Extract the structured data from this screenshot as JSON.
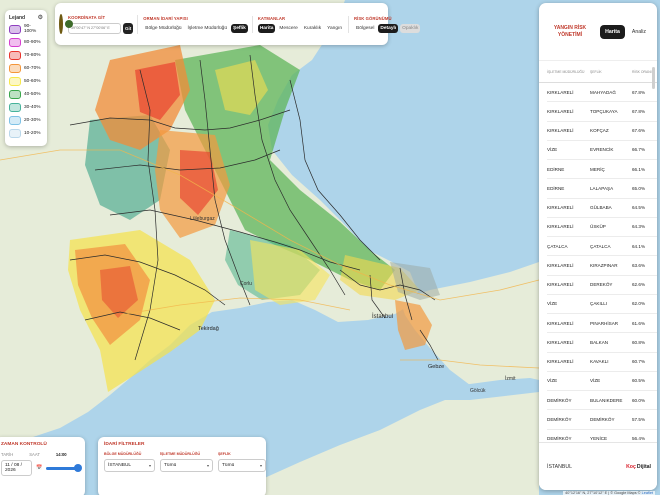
{
  "legend": {
    "title": "Lejand",
    "items": [
      {
        "label": "90-100%",
        "color": "#8e3fbf"
      },
      {
        "label": "80-90%",
        "color": "#d63fd0"
      },
      {
        "label": "70-80%",
        "color": "#e8342d"
      },
      {
        "label": "60-70%",
        "color": "#f4963a"
      },
      {
        "label": "50-60%",
        "color": "#f6e84b"
      },
      {
        "label": "40-50%",
        "color": "#3aa64b"
      },
      {
        "label": "30-40%",
        "color": "#46b39b"
      },
      {
        "label": "20-30%",
        "color": "#7ec2e6"
      },
      {
        "label": "10-20%",
        "color": "#b9d7ea"
      }
    ]
  },
  "toolbar": {
    "coord": {
      "title": "KOORDİNATA GİT",
      "placeholder": "39°00'47\" N 27°00'06\" E",
      "go_label": "Git"
    },
    "admin": {
      "title": "ORMAN İDARİ YAPISI",
      "options": [
        "Bölge Müdürlüğü",
        "İşletme Müdürlüğü",
        "Şeflik"
      ],
      "active_index": 2
    },
    "layers": {
      "title": "KATMANLAR",
      "options": [
        "Harita",
        "Mescere",
        "Kuraklık",
        "Yangın"
      ],
      "active_index": 0
    },
    "risk": {
      "title": "RİSK GÖRÜNÜMÜ",
      "options": [
        "Bölgesel",
        "Detaylı",
        "Opaklık"
      ],
      "active_index": 1,
      "dim_index": 2
    }
  },
  "panel": {
    "title": "YANGIN RİSK YÖNETİMİ",
    "toggle": [
      "Harita",
      "Analiz"
    ],
    "toggle_active": 0,
    "columns": [
      "İŞLETME MÜDÜRLÜĞÜ",
      "ŞEFLİK",
      "RİSK ORANI"
    ],
    "rows": [
      [
        "KIRKLARELİ",
        "MAHYADAĞ",
        "67.8%"
      ],
      [
        "KIRKLARELİ",
        "TOPÇUKAYA",
        "67.8%"
      ],
      [
        "KIRKLARELİ",
        "KOFÇAZ",
        "67.6%"
      ],
      [
        "VİZE",
        "EVRENCİK",
        "66.7%"
      ],
      [
        "EDİRNE",
        "MERİÇ",
        "66.1%"
      ],
      [
        "EDİRNE",
        "LALAPAŞA",
        "65.0%"
      ],
      [
        "KIRKLARELİ",
        "GÜLBABA",
        "64.5%"
      ],
      [
        "KIRKLARELİ",
        "ÜSKÜP",
        "64.3%"
      ],
      [
        "ÇATALCA",
        "ÇATALCA",
        "64.1%"
      ],
      [
        "KIRKLARELİ",
        "KIRAZPINAR",
        "63.6%"
      ],
      [
        "KIRKLARELİ",
        "DEREKÖY",
        "62.6%"
      ],
      [
        "VİZE",
        "ÇAKILLI",
        "62.0%"
      ],
      [
        "KIRKLARELİ",
        "PINARHİSAR",
        "61.6%"
      ],
      [
        "KIRKLARELİ",
        "BALKAN",
        "60.8%"
      ],
      [
        "KIRKLARELİ",
        "KAVAKLI",
        "60.7%"
      ],
      [
        "VİZE",
        "VİZE",
        "60.5%"
      ],
      [
        "DEMİRKÖY",
        "BULANIKDERE",
        "60.0%"
      ],
      [
        "DEMİRKÖY",
        "DEMİRKÖY",
        "57.5%"
      ],
      [
        "DEMİRKÖY",
        "YENİCE",
        "56.4%"
      ]
    ],
    "footer_region": "İSTANBUL",
    "footer_logo_red": "Koç",
    "footer_logo": "Dijital"
  },
  "time_control": {
    "title": "ZAMAN KONTROLÜ",
    "date_label": "TARİH",
    "time_label": "SAAT",
    "time_value": "14:00",
    "date_value": "11 / 08 / 2026"
  },
  "filters": {
    "title": "İDARİ FİLTRELER",
    "fields": [
      {
        "label": "BÖLGE MÜDÜRLÜĞÜ",
        "value": "İSTANBUL"
      },
      {
        "label": "İŞLETME MÜDÜRLÜĞÜ",
        "value": "Tümü"
      },
      {
        "label": "ŞEFLİK",
        "value": "Tümü"
      }
    ]
  },
  "map_labels": {
    "istanbul": "İstanbul",
    "gebze": "Gebze",
    "golcuk": "Gölcük",
    "izmit": "İzmit",
    "tekirdag": "Tekirdağ",
    "corlu": "Çorlu",
    "luleburgaz": "Lüleburgaz"
  },
  "attribution": {
    "text": "40°12'16\" N, 27°10'12\" E | © Google Maps © ",
    "link": "Leaflet",
    "link2": "Harita"
  }
}
